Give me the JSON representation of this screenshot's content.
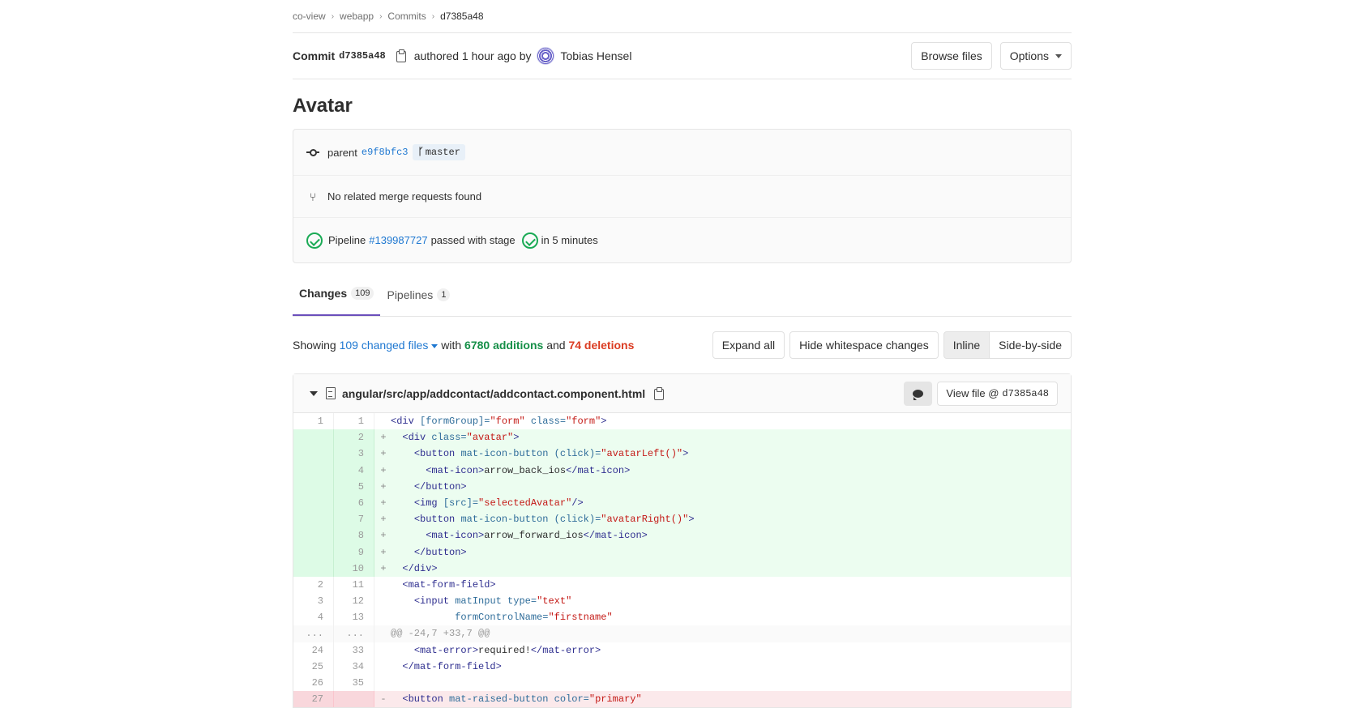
{
  "breadcrumb": {
    "items": [
      "co-view",
      "webapp",
      "Commits"
    ],
    "current": "d7385a48"
  },
  "commit": {
    "label": "Commit",
    "sha": "d7385a48",
    "authored": "authored 1 hour ago by",
    "author": "Tobias Hensel",
    "browse_files": "Browse files",
    "options": "Options",
    "title": "Avatar"
  },
  "info": {
    "parent_label": "parent",
    "parent_sha": "e9f8bfc3",
    "branch": "master",
    "merge_requests": "No related merge requests found",
    "pipeline_label": "Pipeline",
    "pipeline_id": "#139987727",
    "pipeline_status": "passed with stage",
    "pipeline_duration": "in 5 minutes"
  },
  "tabs": [
    {
      "label": "Changes",
      "count": "109",
      "active": true
    },
    {
      "label": "Pipelines",
      "count": "1",
      "active": false
    }
  ],
  "summary": {
    "showing": "Showing",
    "changed_files": "109 changed files",
    "with": "with",
    "additions": "6780 additions",
    "and": "and",
    "deletions": "74 deletions",
    "expand_all": "Expand all",
    "hide_whitespace": "Hide whitespace changes",
    "inline": "Inline",
    "side_by_side": "Side-by-side"
  },
  "file": {
    "path": "angular/src/app/addcontact/addcontact.component.html",
    "view_file": "View file @",
    "view_file_sha": "d7385a48"
  },
  "diff_lines": [
    {
      "type": "ctx",
      "old": "1",
      "new": "1",
      "sign": "",
      "html": "<span class='t'>&lt;div</span> <span class='a'>[formGroup]=</span><span class='s'>\"form\"</span> <span class='a'>class=</span><span class='s'>\"form\"</span><span class='t'>&gt;</span>"
    },
    {
      "type": "add",
      "old": "",
      "new": "2",
      "sign": "+",
      "html": "  <span class='t'>&lt;div</span> <span class='a'>class=</span><span class='s'>\"avatar\"</span><span class='t'>&gt;</span>"
    },
    {
      "type": "add",
      "old": "",
      "new": "3",
      "sign": "+",
      "html": "    <span class='t'>&lt;button</span> <span class='a'>mat-icon-button</span> <span class='a'>(click)=</span><span class='s'>\"avatarLeft()\"</span><span class='t'>&gt;</span>"
    },
    {
      "type": "add",
      "old": "",
      "new": "4",
      "sign": "+",
      "html": "      <span class='t'>&lt;mat-icon&gt;</span>arrow_back_ios<span class='t'>&lt;/mat-icon&gt;</span>"
    },
    {
      "type": "add",
      "old": "",
      "new": "5",
      "sign": "+",
      "html": "    <span class='t'>&lt;/button&gt;</span>"
    },
    {
      "type": "add",
      "old": "",
      "new": "6",
      "sign": "+",
      "html": "    <span class='t'>&lt;img</span> <span class='a'>[src]=</span><span class='s'>\"selectedAvatar\"</span><span class='t'>/&gt;</span>"
    },
    {
      "type": "add",
      "old": "",
      "new": "7",
      "sign": "+",
      "html": "    <span class='t'>&lt;button</span> <span class='a'>mat-icon-button</span> <span class='a'>(click)=</span><span class='s'>\"avatarRight()\"</span><span class='t'>&gt;</span>"
    },
    {
      "type": "add",
      "old": "",
      "new": "8",
      "sign": "+",
      "html": "      <span class='t'>&lt;mat-icon&gt;</span>arrow_forward_ios<span class='t'>&lt;/mat-icon&gt;</span>"
    },
    {
      "type": "add",
      "old": "",
      "new": "9",
      "sign": "+",
      "html": "    <span class='t'>&lt;/button&gt;</span>"
    },
    {
      "type": "add",
      "old": "",
      "new": "10",
      "sign": "+",
      "html": "  <span class='t'>&lt;/div&gt;</span>"
    },
    {
      "type": "ctx",
      "old": "2",
      "new": "11",
      "sign": "",
      "html": "  <span class='t'>&lt;mat-form-field&gt;</span>"
    },
    {
      "type": "ctx",
      "old": "3",
      "new": "12",
      "sign": "",
      "html": "    <span class='t'>&lt;input</span> <span class='a'>matInput</span> <span class='a'>type=</span><span class='s'>\"text\"</span>"
    },
    {
      "type": "ctx",
      "old": "4",
      "new": "13",
      "sign": "",
      "html": "           <span class='a'>formControlName=</span><span class='s'>\"firstname\"</span>"
    },
    {
      "type": "hunk",
      "old": "...",
      "new": "...",
      "sign": "",
      "html": "@@ -24,7 +33,7 @@"
    },
    {
      "type": "ctx",
      "old": "24",
      "new": "33",
      "sign": "",
      "html": "    <span class='t'>&lt;mat-error&gt;</span>required!<span class='t'>&lt;/mat-error&gt;</span>"
    },
    {
      "type": "ctx",
      "old": "25",
      "new": "34",
      "sign": "",
      "html": "  <span class='t'>&lt;/mat-form-field&gt;</span>"
    },
    {
      "type": "ctx",
      "old": "26",
      "new": "35",
      "sign": "",
      "html": ""
    },
    {
      "type": "del",
      "old": "27",
      "new": "",
      "sign": "-",
      "html": "  <span class='t'>&lt;button</span> <span class='a'>mat-raised-button</span> <span class='a'>color=</span><span class='s'>\"primary\"</span>"
    }
  ],
  "colors": {
    "link": "#1f78d1",
    "additions": "#168f48",
    "deletions": "#db3b21",
    "added_line_bg": "#ecfdf0",
    "deleted_line_bg": "#fbe9eb",
    "active_tab_underline": "#6b4fbb",
    "pipeline_passed": "#1aaa55"
  }
}
